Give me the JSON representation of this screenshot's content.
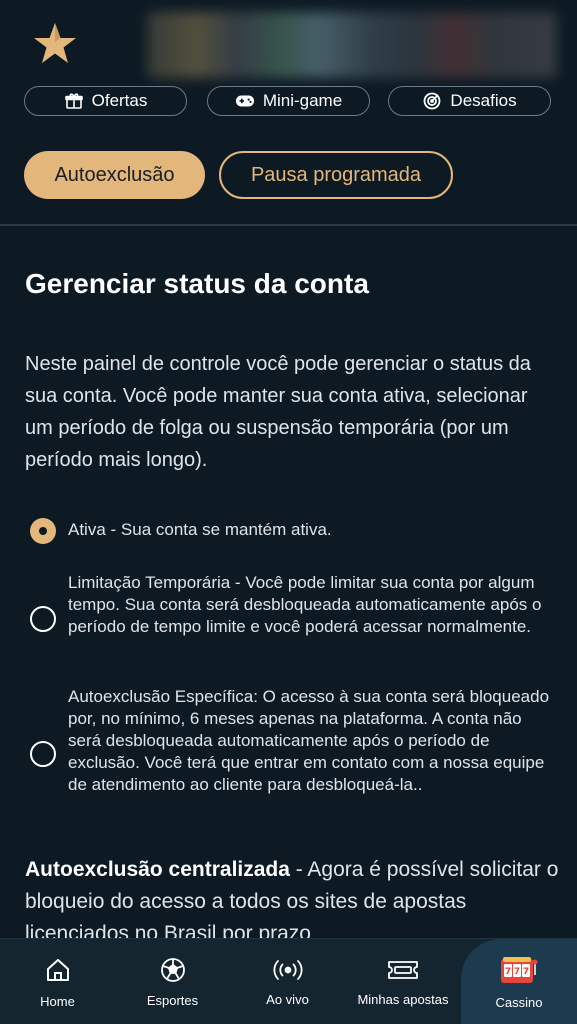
{
  "header": {
    "quick_links": [
      {
        "label": "Ofertas",
        "icon": "gift-icon"
      },
      {
        "label": "Mini-game",
        "icon": "gamepad-icon"
      },
      {
        "label": "Desafios",
        "icon": "target-icon"
      }
    ]
  },
  "tabs": [
    {
      "label": "Autoexclusão",
      "active": true
    },
    {
      "label": "Pausa programada",
      "active": false
    }
  ],
  "main": {
    "title": "Gerenciar status da conta",
    "intro": "Neste painel de controle você pode gerenciar o status da sua conta. Você pode manter sua conta ativa, selecionar um período de folga ou suspensão temporária (por um período mais longo).",
    "options": [
      {
        "text": "Ativa - Sua conta se mantém ativa.",
        "selected": true
      },
      {
        "text": "Limitação Temporária - Você pode limitar sua conta por algum tempo. Sua conta será desbloqueada automaticamente após o período de tempo limite e você poderá acessar normalmente.",
        "selected": false
      },
      {
        "text": "Autoexclusão Específica: O acesso à sua conta será bloqueado por, no mínimo, 6 meses apenas na plataforma. A conta não será desbloqueada automaticamente após o período de exclusão. Você terá que entrar em contato com a nossa equipe de atendimento ao cliente para desbloqueá-la..",
        "selected": false
      }
    ],
    "centralized_title": "Autoexclusão centralizada",
    "centralized_text": " - Agora é possível solicitar o bloqueio do acesso a todos os sites de apostas licenciados no Brasil por prazo"
  },
  "bottom_nav": [
    {
      "label": "Home",
      "icon": "home-icon"
    },
    {
      "label": "Esportes",
      "icon": "soccer-ball-icon"
    },
    {
      "label": "Ao vivo",
      "icon": "live-broadcast-icon"
    },
    {
      "label": "Minhas apostas",
      "icon": "ticket-icon"
    },
    {
      "label": "Cassino",
      "icon": "slot-machine-icon",
      "active": true
    }
  ],
  "colors": {
    "accent": "#e3b67c",
    "background": "#0d1a24",
    "nav_background": "#142530"
  }
}
